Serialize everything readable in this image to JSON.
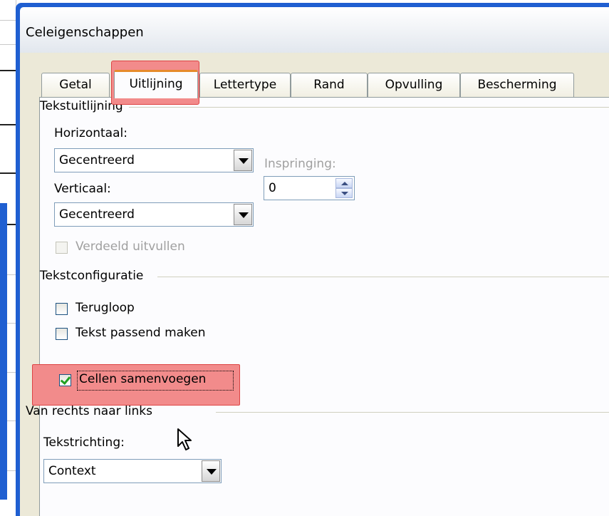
{
  "dialog": {
    "title": "Celeigenschappen"
  },
  "tabs": [
    {
      "label": "Getal",
      "active": false
    },
    {
      "label": "Uitlijning",
      "active": true
    },
    {
      "label": "Lettertype",
      "active": false
    },
    {
      "label": "Rand",
      "active": false
    },
    {
      "label": "Opvulling",
      "active": false
    },
    {
      "label": "Bescherming",
      "active": false
    }
  ],
  "text_alignment": {
    "group_label": "Tekstuitlijning",
    "horizontal_label": "Horizontaal:",
    "horizontal_value": "Gecentreerd",
    "vertical_label": "Verticaal:",
    "vertical_value": "Gecentreerd",
    "indent_label": "Inspringing:",
    "indent_value": "0",
    "justify_distributed_label": "Verdeeld uitvullen"
  },
  "text_control": {
    "group_label": "Tekstconfiguratie",
    "wrap_label": "Terugloop",
    "shrink_label": "Tekst passend maken",
    "merge_label": "Cellen samenvoegen",
    "wrap_checked": false,
    "shrink_checked": false,
    "merge_checked": true
  },
  "rtl": {
    "group_label": "Van rechts naar links",
    "direction_label": "Tekstrichting:",
    "direction_value": "Context"
  },
  "colors": {
    "highlight": "#f28b8b",
    "dialog_frame": "#1f5fd1",
    "active_tab_accent": "#e68b2c"
  }
}
